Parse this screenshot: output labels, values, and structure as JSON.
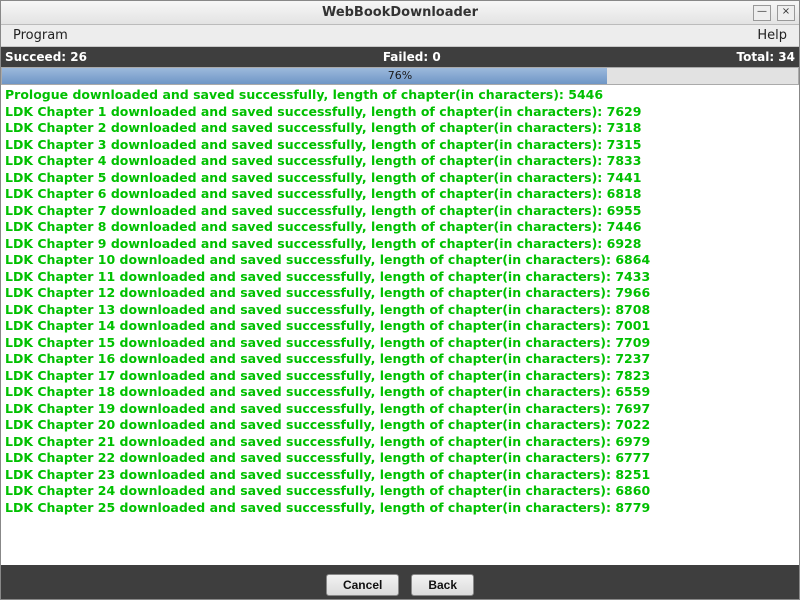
{
  "window": {
    "title": "WebBookDownloader",
    "minimize_glyph": "—",
    "close_glyph": "×"
  },
  "menubar": {
    "program": "Program",
    "help": "Help"
  },
  "status": {
    "succeed_label": "Succeed: 26",
    "failed_label": "Failed: 0",
    "total_label": "Total: 34"
  },
  "progress": {
    "percent_text": "76%",
    "percent": 76
  },
  "log": [
    "Prologue downloaded and saved successfully, length of chapter(in characters): 5446",
    "LDK Chapter 1 downloaded and saved successfully, length of chapter(in characters): 7629",
    "LDK Chapter 2 downloaded and saved successfully, length of chapter(in characters): 7318",
    "LDK Chapter 3 downloaded and saved successfully, length of chapter(in characters): 7315",
    "LDK Chapter 4 downloaded and saved successfully, length of chapter(in characters): 7833",
    "LDK Chapter 5 downloaded and saved successfully, length of chapter(in characters): 7441",
    "LDK Chapter 6 downloaded and saved successfully, length of chapter(in characters): 6818",
    "LDK Chapter 7 downloaded and saved successfully, length of chapter(in characters): 6955",
    "LDK Chapter 8 downloaded and saved successfully, length of chapter(in characters): 7446",
    "LDK Chapter 9 downloaded and saved successfully, length of chapter(in characters): 6928",
    "LDK Chapter 10 downloaded and saved successfully, length of chapter(in characters): 6864",
    "LDK Chapter 11 downloaded and saved successfully, length of chapter(in characters): 7433",
    "LDK Chapter 12 downloaded and saved successfully, length of chapter(in characters): 7966",
    "LDK Chapter 13 downloaded and saved successfully, length of chapter(in characters): 8708",
    "LDK Chapter 14 downloaded and saved successfully, length of chapter(in characters): 7001",
    "LDK Chapter 15 downloaded and saved successfully, length of chapter(in characters): 7709",
    "LDK Chapter 16 downloaded and saved successfully, length of chapter(in characters): 7237",
    "LDK Chapter 17 downloaded and saved successfully, length of chapter(in characters): 7823",
    "LDK Chapter 18 downloaded and saved successfully, length of chapter(in characters): 6559",
    "LDK Chapter 19 downloaded and saved successfully, length of chapter(in characters): 7697",
    "LDK Chapter 20 downloaded and saved successfully, length of chapter(in characters): 7022",
    "LDK Chapter 21 downloaded and saved successfully, length of chapter(in characters): 6979",
    "LDK Chapter 22 downloaded and saved successfully, length of chapter(in characters): 6777",
    "LDK Chapter 23 downloaded and saved successfully, length of chapter(in characters): 8251",
    "LDK Chapter 24 downloaded and saved successfully, length of chapter(in characters): 6860",
    "LDK Chapter 25 downloaded and saved successfully, length of chapter(in characters): 8779"
  ],
  "footer": {
    "cancel": "Cancel",
    "back": "Back"
  }
}
